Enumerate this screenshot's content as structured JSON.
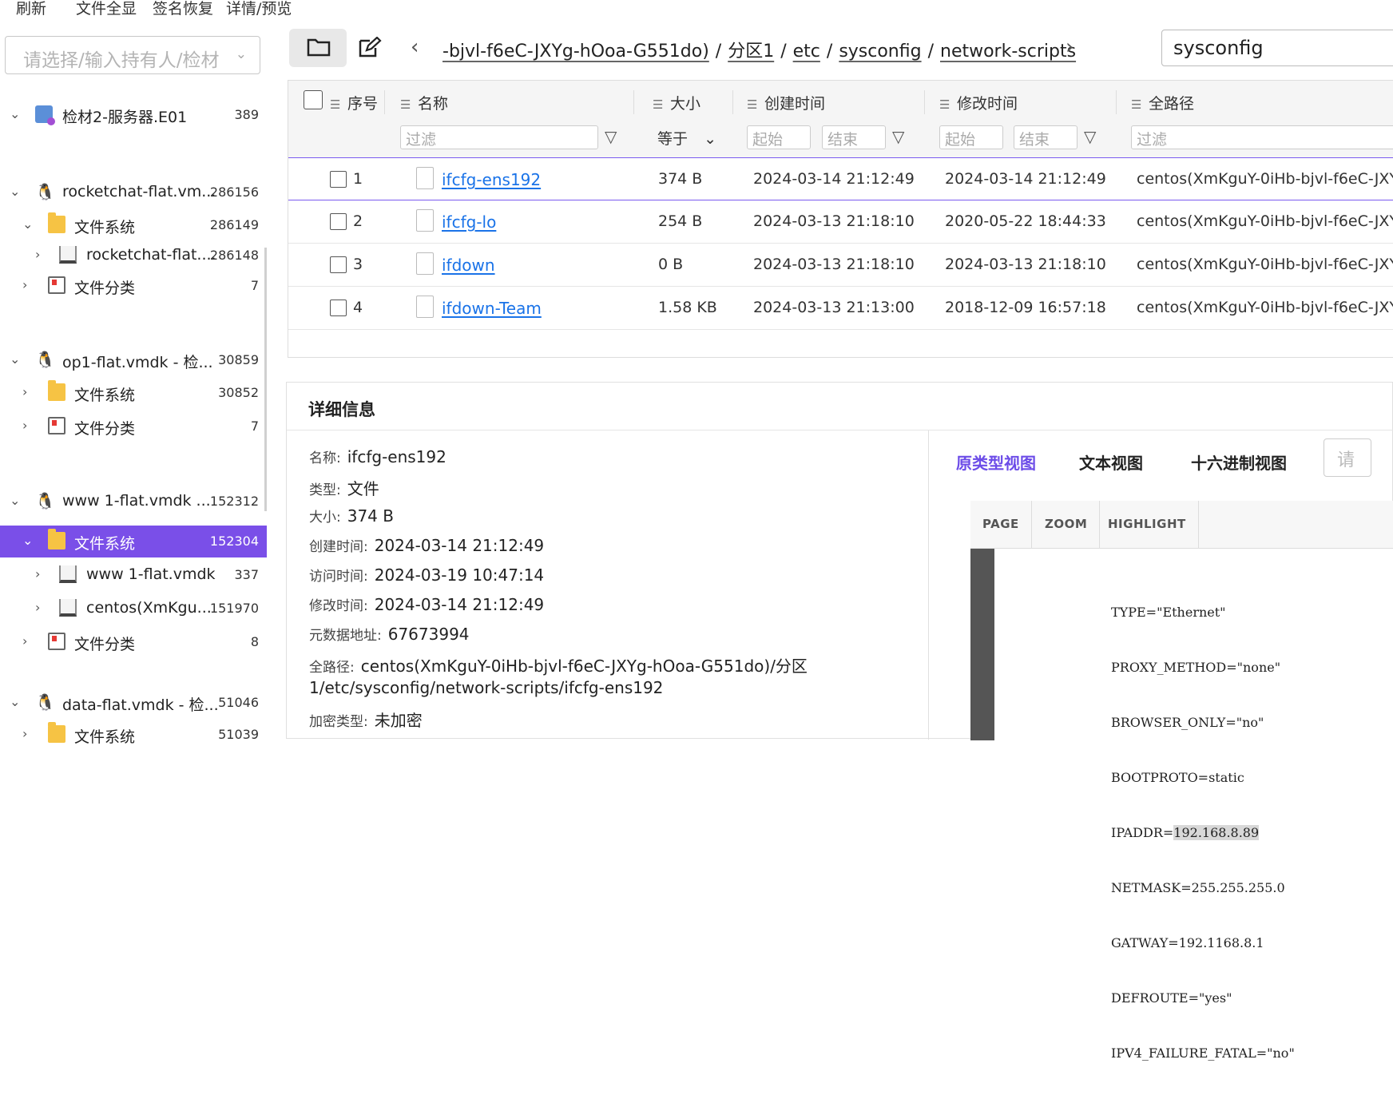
{
  "top_menu": [
    "刷新",
    "文件全显",
    "签名恢复",
    "详情/预览"
  ],
  "owner_select": {
    "placeholder": "请选择/输入持有人/检材"
  },
  "tree": [
    {
      "label": "检材2-服务器.E01",
      "count": "389",
      "icon": "evidence-e01-icon"
    },
    {
      "label": "rocketchat-flat.vm...",
      "count": "286156",
      "icon": "linux-penguin-icon"
    },
    {
      "label": "文件系统",
      "count": "286149",
      "icon": "folder-icon"
    },
    {
      "label": "rocketchat-flat....",
      "count": "286148",
      "icon": "disk-icon"
    },
    {
      "label": "文件分类",
      "count": "7",
      "icon": "file-category-icon"
    },
    {
      "label": "op1-flat.vmdk - 检...",
      "count": "30859",
      "icon": "linux-penguin-icon"
    },
    {
      "label": "文件系统",
      "count": "30852",
      "icon": "folder-icon"
    },
    {
      "label": "文件分类",
      "count": "7",
      "icon": "file-category-icon"
    },
    {
      "label": "www 1-flat.vmdk ...",
      "count": "152312",
      "icon": "linux-penguin-icon"
    },
    {
      "label": "文件系统",
      "count": "152304",
      "icon": "folder-icon"
    },
    {
      "label": "www 1-flat.vmdk",
      "count": "337",
      "icon": "disk-icon"
    },
    {
      "label": "centos(XmKgu...",
      "count": "151970",
      "icon": "disk-icon"
    },
    {
      "label": "文件分类",
      "count": "8",
      "icon": "file-category-icon"
    },
    {
      "label": "data-flat.vmdk - 检...",
      "count": "51046",
      "icon": "linux-penguin-icon"
    },
    {
      "label": "文件系统",
      "count": "51039",
      "icon": "folder-icon"
    }
  ],
  "breadcrumb": {
    "segments": [
      "-bjvl-f6eC-JXYg-hOoa-G551do)",
      "分区1",
      "etc",
      "sysconfig",
      "network-scripts"
    ],
    "separator": "/"
  },
  "search": {
    "value": "sysconfig"
  },
  "table": {
    "headers": [
      "序号",
      "名称",
      "大小",
      "创建时间",
      "修改时间",
      "全路径"
    ],
    "filters": {
      "name": "过滤",
      "size_op": "等于",
      "start": "起始",
      "end": "结束",
      "path": "过滤"
    },
    "rows": [
      {
        "idx": "1",
        "name": "ifcfg-ens192",
        "size": "374 B",
        "created": "2024-03-14 21:12:49",
        "modified": "2024-03-14 21:12:49",
        "path": "centos(XmKguY-0iHb-bjvl-f6eC-JXY"
      },
      {
        "idx": "2",
        "name": "ifcfg-lo",
        "size": "254 B",
        "created": "2024-03-13 21:18:10",
        "modified": "2020-05-22 18:44:33",
        "path": "centos(XmKguY-0iHb-bjvl-f6eC-JXY"
      },
      {
        "idx": "3",
        "name": "ifdown",
        "size": "0 B",
        "created": "2024-03-13 21:18:10",
        "modified": "2024-03-13 21:18:10",
        "path": "centos(XmKguY-0iHb-bjvl-f6eC-JXY"
      },
      {
        "idx": "4",
        "name": "ifdown-Team",
        "size": "1.58 KB",
        "created": "2024-03-13 21:13:00",
        "modified": "2018-12-09 16:57:18",
        "path": "centos(XmKguY-0iHb-bjvl-f6eC-JXY"
      }
    ]
  },
  "details": {
    "title": "详细信息",
    "props": [
      {
        "key": "名称:",
        "value": "ifcfg-ens192"
      },
      {
        "key": "类型:",
        "value": "文件"
      },
      {
        "key": "大小:",
        "value": "374 B"
      },
      {
        "key": "创建时间:",
        "value": "2024-03-14 21:12:49"
      },
      {
        "key": "访问时间:",
        "value": "2024-03-19 10:47:14"
      },
      {
        "key": "修改时间:",
        "value": "2024-03-14 21:12:49"
      },
      {
        "key": "元数据地址:",
        "value": "67673994"
      },
      {
        "key": "全路径:",
        "value": "centos(XmKguY-0iHb-bjvl-f6eC-JXYg-hOoa-G551do)/分区"
      },
      {
        "key": "",
        "value": "1/etc/sysconfig/network-scripts/ifcfg-ens192"
      },
      {
        "key": "加密类型:",
        "value": "未加密"
      }
    ]
  },
  "viewer": {
    "tabs": [
      "原类型视图",
      "文本视图",
      "十六进制视图"
    ],
    "search_placeholder": "请",
    "toolbar": [
      "PAGE",
      "ZOOM",
      "HIGHLIGHT"
    ],
    "lines": [
      "TYPE=\"Ethernet\"",
      "PROXY_METHOD=\"none\"",
      "BROWSER_ONLY=\"no\"",
      "BOOTPROTO=static",
      "IPADDR=",
      "NETMASK=255.255.255.0",
      "GATWAY=192.1168.8.1",
      "DEFROUTE=\"yes\"",
      "IPV4_FAILURE_FATAL=\"no\""
    ],
    "highlighted_value": "192.168.8.89"
  }
}
